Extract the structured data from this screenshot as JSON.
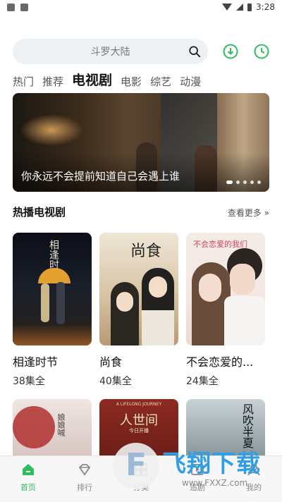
{
  "status_bar": {
    "time": "3:28"
  },
  "search": {
    "placeholder": "斗罗大陆"
  },
  "tabs": [
    {
      "label": "热门"
    },
    {
      "label": "推荐"
    },
    {
      "label": "电视剧",
      "active": true
    },
    {
      "label": "电影"
    },
    {
      "label": "综艺"
    },
    {
      "label": "动漫"
    }
  ],
  "banner": {
    "caption": "你永远不会提前知道自己会遇上谁",
    "dots": 5,
    "active_dot": 0
  },
  "section": {
    "title": "热播电视剧",
    "more": "查看更多 »"
  },
  "cards": [
    {
      "title": "相逢时节",
      "episodes": "38集全",
      "poster_text": "相逢时节"
    },
    {
      "title": "尚食",
      "episodes": "40集全",
      "poster_text": "尚食"
    },
    {
      "title": "不会恋爱的...",
      "episodes": "24集全",
      "poster_text": "不会恋爱的我们"
    }
  ],
  "second_row": [
    {
      "poster_text": "娘娘喊"
    },
    {
      "poster_text": "人世间",
      "poster_sub": "A LIFELONG JOURNEY",
      "poster_sub2": "今日开播"
    },
    {
      "poster_text": "风吹半夏"
    }
  ],
  "bottom_nav": [
    {
      "label": "首页",
      "icon": "home-icon",
      "active": true
    },
    {
      "label": "排行",
      "icon": "diamond-icon"
    },
    {
      "label": "分类",
      "icon": "category-icon"
    },
    {
      "label": "追剧",
      "icon": "follow-icon"
    },
    {
      "label": "我的",
      "icon": "profile-icon"
    }
  ],
  "watermark": {
    "brand": "飞翔下载",
    "url": "www.FXXZ.com"
  },
  "colors": {
    "accent": "#2fbf5f",
    "text": "#111111",
    "search_bg": "#eef1f3"
  }
}
